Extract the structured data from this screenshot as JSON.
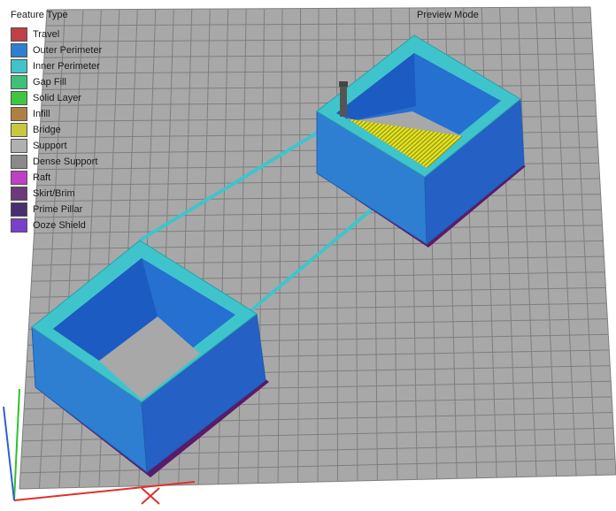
{
  "legend": {
    "title": "Feature Type",
    "items": [
      {
        "label": "Travel",
        "color": "#c0404a"
      },
      {
        "label": "Outer Perimeter",
        "color": "#2e7fd1"
      },
      {
        "label": "Inner Perimeter",
        "color": "#40c4cc"
      },
      {
        "label": "Gap Fill",
        "color": "#3cc07a"
      },
      {
        "label": "Solid Layer",
        "color": "#3ec640"
      },
      {
        "label": "Infill",
        "color": "#b08040"
      },
      {
        "label": "Bridge",
        "color": "#c8c840"
      },
      {
        "label": "Support",
        "color": "#b0b0b0"
      },
      {
        "label": "Dense Support",
        "color": "#8a8a8a"
      },
      {
        "label": "Raft",
        "color": "#c040c4"
      },
      {
        "label": "Skirt/Brim",
        "color": "#6a3a7a"
      },
      {
        "label": "Prime Pillar",
        "color": "#4a2e6e"
      },
      {
        "label": "Ooze Shield",
        "color": "#7a40cc"
      }
    ]
  },
  "viewer": {
    "mode_label": "Preview Mode",
    "bed_color": "#a8a8a8",
    "grid_color": "#7e7e7e",
    "background_color": "#ffffff",
    "axis_colors": {
      "x": "#e03030",
      "y": "#30c030",
      "z": "#3060d0"
    },
    "travel_color": "#40c4cc",
    "bridge_color": "#e0e020",
    "nozzle_color": "#555555"
  }
}
